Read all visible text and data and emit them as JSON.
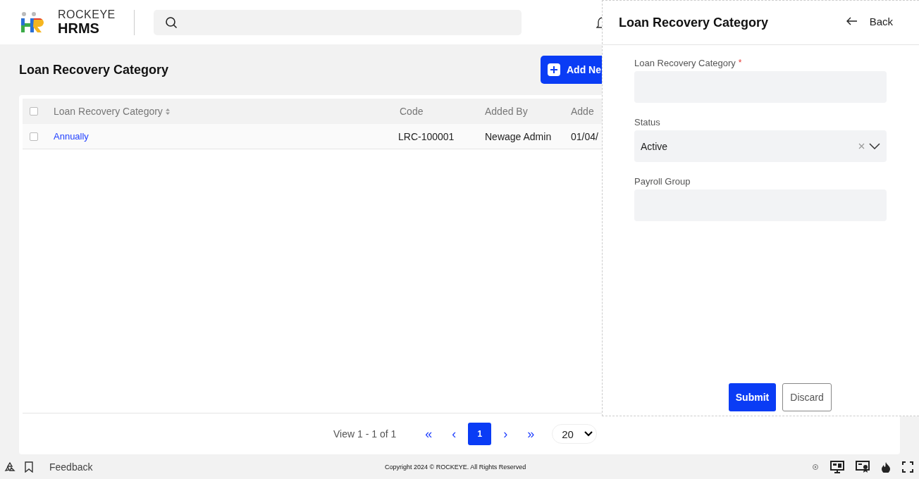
{
  "header": {
    "brand_top": "ROCKEYE",
    "brand_bottom": "HRMS"
  },
  "page": {
    "title": "Loan Recovery Category",
    "add_button": "Add Ne"
  },
  "table": {
    "select_all_checked": false,
    "columns": [
      {
        "label": "Loan Recovery Category",
        "sortable": true
      },
      {
        "label": "Code",
        "sortable": false
      },
      {
        "label": "Added By",
        "sortable": false
      },
      {
        "label": "Adde",
        "sortable": false
      }
    ],
    "rows": [
      {
        "checked": false,
        "cells": [
          "Annually",
          "LRC-100001",
          "Newage Admin",
          "01/04/"
        ]
      }
    ]
  },
  "pagination": {
    "summary": "View 1 - 1 of 1",
    "first": "«",
    "prev": "‹",
    "pages": [
      {
        "label": "1",
        "selected": true
      }
    ],
    "next": "›",
    "last": "»",
    "page_size": "20"
  },
  "footer": {
    "feedback": "Feedback",
    "copyright": "Copyright 2024 © ROCKEYE. All Rights Reserved"
  },
  "panel": {
    "title": "Loan Recovery Category",
    "back": "Back",
    "fields": [
      {
        "kind": "text",
        "label": "Loan Recovery Category",
        "required_mark": "*"
      },
      {
        "kind": "select",
        "label": "Status",
        "value": "Active"
      },
      {
        "kind": "text",
        "label": "Payroll Group"
      }
    ],
    "submit": "Submit",
    "discard": "Discard"
  }
}
